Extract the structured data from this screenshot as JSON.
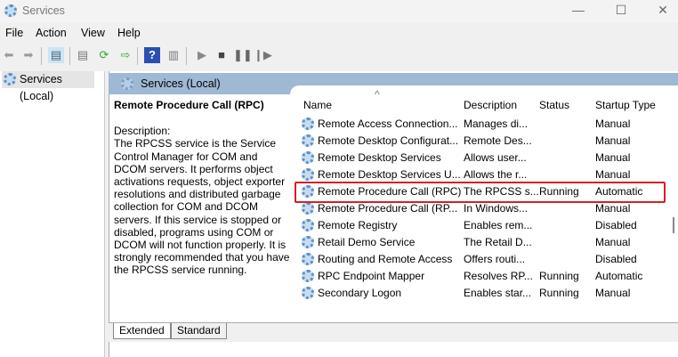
{
  "window": {
    "title": "Services",
    "min": "—",
    "max": "☐",
    "close": "✕"
  },
  "menu": [
    "File",
    "Action",
    "View",
    "Help"
  ],
  "tree": {
    "item": "Services (Local)"
  },
  "pane": {
    "header": "Services (Local)",
    "selected_name": "Remote Procedure Call (RPC)",
    "description_label": "Description:",
    "description": "The RPCSS service is the Service Control Manager for COM and DCOM servers. It performs object activations requests, object exporter resolutions and distributed garbage collection for COM and DCOM servers. If this service is stopped or disabled, programs using COM or DCOM will not function properly. It is strongly recommended that you have the RPCSS service running."
  },
  "columns": [
    "Name",
    "Description",
    "Status",
    "Startup Type"
  ],
  "rows": [
    {
      "name": "Remote Access Connection...",
      "desc": "Manages di...",
      "status": "",
      "startup": "Manual"
    },
    {
      "name": "Remote Desktop Configurat...",
      "desc": "Remote Des...",
      "status": "",
      "startup": "Manual"
    },
    {
      "name": "Remote Desktop Services",
      "desc": "Allows user...",
      "status": "",
      "startup": "Manual"
    },
    {
      "name": "Remote Desktop Services U...",
      "desc": "Allows the r...",
      "status": "",
      "startup": "Manual"
    },
    {
      "name": "Remote Procedure Call (RPC)",
      "desc": "The RPCSS s...",
      "status": "Running",
      "startup": "Automatic"
    },
    {
      "name": "Remote Procedure Call (RP...",
      "desc": "In Windows...",
      "status": "",
      "startup": "Manual"
    },
    {
      "name": "Remote Registry",
      "desc": "Enables rem...",
      "status": "",
      "startup": "Disabled"
    },
    {
      "name": "Retail Demo Service",
      "desc": "The Retail D...",
      "status": "",
      "startup": "Manual"
    },
    {
      "name": "Routing and Remote Access",
      "desc": "Offers routi...",
      "status": "",
      "startup": "Disabled"
    },
    {
      "name": "RPC Endpoint Mapper",
      "desc": "Resolves RP...",
      "status": "Running",
      "startup": "Automatic"
    },
    {
      "name": "Secondary Logon",
      "desc": "Enables star...",
      "status": "Running",
      "startup": "Manual"
    }
  ],
  "tabs": [
    "Extended",
    "Standard"
  ],
  "highlight_color": "#d2202a"
}
